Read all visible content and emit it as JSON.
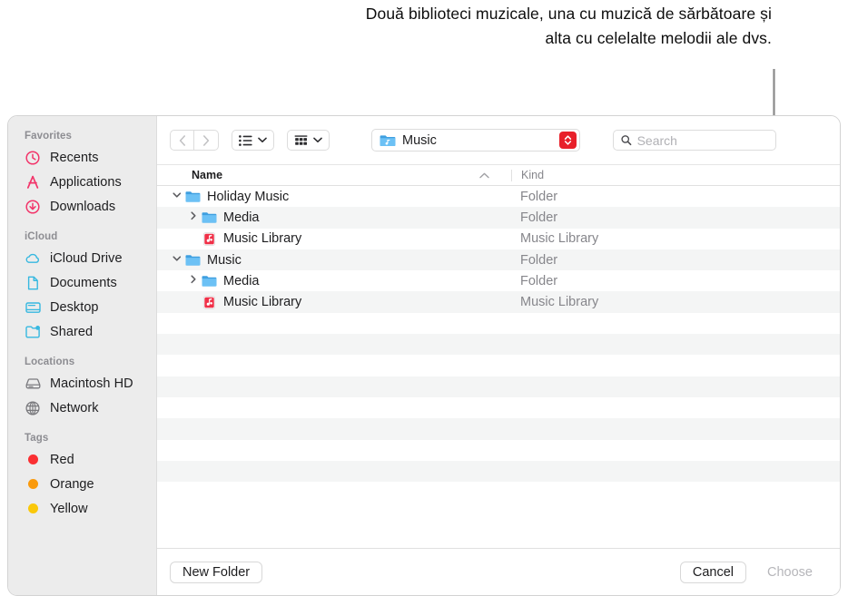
{
  "annotation": {
    "text": "Două biblioteci muzicale, una cu muzică de sărbătoare și alta cu celelalte melodii ale dvs."
  },
  "window": {
    "toolbar": {
      "back_icon": "chevron-left-icon",
      "forward_icon": "chevron-right-icon",
      "view_list_icon": "list-view-icon",
      "group_icon": "group-by-icon",
      "path_label": "Music",
      "path_folder_icon": "music-folder-icon",
      "stepper_icon": "up-down-chevron-icon",
      "search_placeholder": "Search",
      "search_value": ""
    },
    "columns": {
      "name": "Name",
      "kind": "Kind",
      "sort_arrow": "▲"
    },
    "rows": [
      {
        "name": "Holiday Music",
        "kind": "Folder",
        "indent": 0,
        "disclosure": "open",
        "icon": "folder-icon"
      },
      {
        "name": "Media",
        "kind": "Folder",
        "indent": 1,
        "disclosure": "closed",
        "icon": "folder-icon"
      },
      {
        "name": "Music Library",
        "kind": "Music Library",
        "indent": 1,
        "disclosure": "none",
        "icon": "music-library-icon"
      },
      {
        "name": "Music",
        "kind": "Folder",
        "indent": 0,
        "disclosure": "open",
        "icon": "folder-icon"
      },
      {
        "name": "Media",
        "kind": "Folder",
        "indent": 1,
        "disclosure": "closed",
        "icon": "folder-icon"
      },
      {
        "name": "Music Library",
        "kind": "Music Library",
        "indent": 1,
        "disclosure": "none",
        "icon": "music-library-icon"
      }
    ],
    "empty_row_count": 9,
    "buttons": {
      "new_folder": "New Folder",
      "cancel": "Cancel",
      "choose": "Choose"
    }
  },
  "sidebar": {
    "groups": [
      {
        "title": "Favorites",
        "items": [
          {
            "label": "Recents",
            "icon": "clock-icon",
            "color": "#f2356a"
          },
          {
            "label": "Applications",
            "icon": "applications-icon",
            "color": "#f2356a"
          },
          {
            "label": "Downloads",
            "icon": "download-icon",
            "color": "#f2356a"
          }
        ]
      },
      {
        "title": "iCloud",
        "items": [
          {
            "label": "iCloud Drive",
            "icon": "cloud-icon",
            "color": "#36b8e0"
          },
          {
            "label": "Documents",
            "icon": "document-icon",
            "color": "#36b8e0"
          },
          {
            "label": "Desktop",
            "icon": "desktop-icon",
            "color": "#36b8e0"
          },
          {
            "label": "Shared",
            "icon": "shared-folder-icon",
            "color": "#36b8e0"
          }
        ]
      },
      {
        "title": "Locations",
        "items": [
          {
            "label": "Macintosh HD",
            "icon": "hard-drive-icon",
            "color": "#7a7a7e"
          },
          {
            "label": "Network",
            "icon": "globe-icon",
            "color": "#7a7a7e"
          }
        ]
      },
      {
        "title": "Tags",
        "items": [
          {
            "label": "Red",
            "icon": "tag-dot-icon",
            "color": "#fa2f32"
          },
          {
            "label": "Orange",
            "icon": "tag-dot-icon",
            "color": "#fa9a0c"
          },
          {
            "label": "Yellow",
            "icon": "tag-dot-icon",
            "color": "#fac80a"
          }
        ]
      }
    ]
  },
  "colors": {
    "accent_red": "#e8202a",
    "folder_blue": "#4aa8ea",
    "sidebar_bg": "#ececec",
    "row_stripe": "#f4f5f5"
  }
}
